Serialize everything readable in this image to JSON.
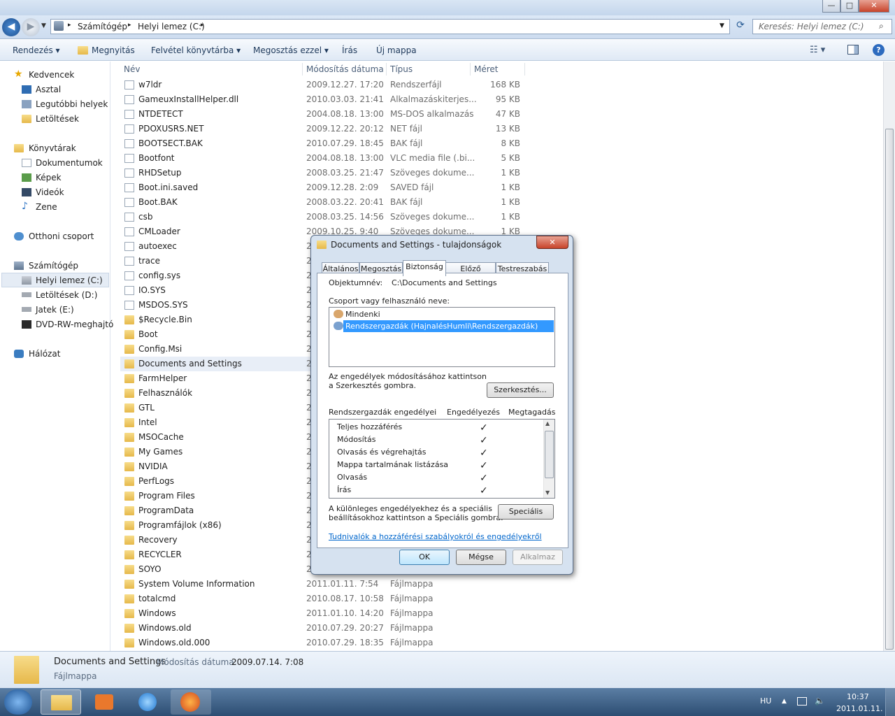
{
  "titlebar": {
    "minimize": "—",
    "maximize": "□",
    "close": "✕"
  },
  "address": {
    "part1": "Számítógép",
    "sep": "▸",
    "part2": "Helyi lemez (C:)",
    "sep2": "▸"
  },
  "search": {
    "placeholder": "Keresés: Helyi lemez (C:)"
  },
  "toolbar": {
    "organize": "Rendezés ▾",
    "open": "Megnyitás",
    "library": "Felvétel könyvtárba ▾",
    "share": "Megosztás ezzel ▾",
    "burn": "Írás",
    "newfolder": "Új mappa"
  },
  "sidebar": {
    "favorites": "Kedvencek",
    "desktop": "Asztal",
    "recent": "Legutóbbi helyek",
    "downloads": "Letöltések",
    "libraries": "Könyvtárak",
    "documents": "Dokumentumok",
    "pictures": "Képek",
    "videos": "Videók",
    "music": "Zene",
    "homegroup": "Otthoni csoport",
    "computer": "Számítógép",
    "drive_c": "Helyi lemez (C:)",
    "drive_d": "Letöltések (D:)",
    "drive_e": "Jatek (E:)",
    "dvd": "DVD-RW-meghajtó",
    "network": "Hálózat"
  },
  "columns": {
    "name": "Név",
    "date": "Módosítás dátuma",
    "type": "Típus",
    "size": "Méret"
  },
  "files": [
    {
      "name": "w7ldr",
      "date": "2009.12.27. 17:20",
      "type": "Rendszerfájl",
      "size": "168 KB",
      "kind": "file"
    },
    {
      "name": "GameuxInstallHelper.dll",
      "date": "2010.03.03. 21:41",
      "type": "Alkalmazáskiterjes...",
      "size": "95 KB",
      "kind": "file"
    },
    {
      "name": "NTDETECT",
      "date": "2004.08.18. 13:00",
      "type": "MS-DOS alkalmazás",
      "size": "47 KB",
      "kind": "file"
    },
    {
      "name": "PDOXUSRS.NET",
      "date": "2009.12.22. 20:12",
      "type": "NET fájl",
      "size": "13 KB",
      "kind": "file"
    },
    {
      "name": "BOOTSECT.BAK",
      "date": "2010.07.29. 18:45",
      "type": "BAK fájl",
      "size": "8 KB",
      "kind": "file"
    },
    {
      "name": "Bootfont",
      "date": "2004.08.18. 13:00",
      "type": "VLC media file (.bi...",
      "size": "5 KB",
      "kind": "file"
    },
    {
      "name": "RHDSetup",
      "date": "2008.03.25. 21:47",
      "type": "Szöveges dokume...",
      "size": "1 KB",
      "kind": "file"
    },
    {
      "name": "Boot.ini.saved",
      "date": "2009.12.28. 2:09",
      "type": "SAVED fájl",
      "size": "1 KB",
      "kind": "file"
    },
    {
      "name": "Boot.BAK",
      "date": "2008.03.22. 20:41",
      "type": "BAK fájl",
      "size": "1 KB",
      "kind": "file"
    },
    {
      "name": "csb",
      "date": "2008.03.25. 14:56",
      "type": "Szöveges dokume...",
      "size": "1 KB",
      "kind": "file"
    },
    {
      "name": "CMLoader",
      "date": "2009.10.25. 9:40",
      "type": "Szöveges dokume...",
      "size": "1 KB",
      "kind": "file"
    },
    {
      "name": "autoexec",
      "date": "2",
      "type": "",
      "size": "",
      "kind": "file"
    },
    {
      "name": "trace",
      "date": "2",
      "type": "",
      "size": "",
      "kind": "file"
    },
    {
      "name": "config.sys",
      "date": "2",
      "type": "",
      "size": "",
      "kind": "file"
    },
    {
      "name": "IO.SYS",
      "date": "2",
      "type": "",
      "size": "",
      "kind": "file"
    },
    {
      "name": "MSDOS.SYS",
      "date": "2",
      "type": "",
      "size": "",
      "kind": "file"
    },
    {
      "name": "$Recycle.Bin",
      "date": "2",
      "type": "",
      "size": "",
      "kind": "folder"
    },
    {
      "name": "Boot",
      "date": "2",
      "type": "",
      "size": "",
      "kind": "folder"
    },
    {
      "name": "Config.Msi",
      "date": "2",
      "type": "",
      "size": "",
      "kind": "folder"
    },
    {
      "name": "Documents and Settings",
      "date": "2",
      "type": "",
      "size": "",
      "kind": "folder"
    },
    {
      "name": "FarmHelper",
      "date": "2",
      "type": "",
      "size": "",
      "kind": "folder"
    },
    {
      "name": "Felhasználók",
      "date": "2",
      "type": "",
      "size": "",
      "kind": "folder"
    },
    {
      "name": "GTL",
      "date": "2",
      "type": "",
      "size": "",
      "kind": "folder"
    },
    {
      "name": "Intel",
      "date": "2",
      "type": "",
      "size": "",
      "kind": "folder"
    },
    {
      "name": "MSOCache",
      "date": "2",
      "type": "",
      "size": "",
      "kind": "folder"
    },
    {
      "name": "My Games",
      "date": "2",
      "type": "",
      "size": "",
      "kind": "folder"
    },
    {
      "name": "NVIDIA",
      "date": "2",
      "type": "",
      "size": "",
      "kind": "folder"
    },
    {
      "name": "PerfLogs",
      "date": "2",
      "type": "",
      "size": "",
      "kind": "folder"
    },
    {
      "name": "Program Files",
      "date": "2",
      "type": "",
      "size": "",
      "kind": "folder"
    },
    {
      "name": "ProgramData",
      "date": "2",
      "type": "",
      "size": "",
      "kind": "folder"
    },
    {
      "name": "Programfájlok (x86)",
      "date": "2",
      "type": "",
      "size": "",
      "kind": "folder"
    },
    {
      "name": "Recovery",
      "date": "2",
      "type": "",
      "size": "",
      "kind": "folder"
    },
    {
      "name": "RECYCLER",
      "date": "2",
      "type": "",
      "size": "",
      "kind": "folder"
    },
    {
      "name": "SOYO",
      "date": "2",
      "type": "",
      "size": "",
      "kind": "folder"
    },
    {
      "name": "System Volume Information",
      "date": "2011.01.11. 7:54",
      "type": "Fájlmappa",
      "size": "",
      "kind": "folder"
    },
    {
      "name": "totalcmd",
      "date": "2010.08.17. 10:58",
      "type": "Fájlmappa",
      "size": "",
      "kind": "folder"
    },
    {
      "name": "Windows",
      "date": "2011.01.10. 14:20",
      "type": "Fájlmappa",
      "size": "",
      "kind": "folder"
    },
    {
      "name": "Windows.old",
      "date": "2010.07.29. 20:27",
      "type": "Fájlmappa",
      "size": "",
      "kind": "folder"
    },
    {
      "name": "Windows.old.000",
      "date": "2010.07.29. 18:35",
      "type": "Fájlmappa",
      "size": "",
      "kind": "folder"
    }
  ],
  "details": {
    "name": "Documents and Settings",
    "date_label": "Módosítás dátuma:",
    "date_value": "2009.07.14. 7:08",
    "type": "Fájlmappa"
  },
  "taskbar": {
    "lang": "HU",
    "time": "10:37",
    "date": "2011.01.11."
  },
  "dialog": {
    "title": "Documents and Settings - tulajdonságok",
    "close": "✕",
    "tabs": [
      "Általános",
      "Megosztás",
      "Biztonság",
      "Előző verziók",
      "Testreszabás"
    ],
    "object_label": "Objektumnév:",
    "object_value": "C:\\Documents and Settings",
    "group_label": "Csoport vagy felhasználó neve:",
    "users": [
      "Mindenki",
      "Rendszergazdák (HajnalésHumli\\Rendszergazdák)"
    ],
    "edit_hint_1": "Az engedélyek módosításához kattintson",
    "edit_hint_2": "a Szerkesztés gombra.",
    "edit_button": "Szerkesztés...",
    "perm_header": "Rendszergazdák engedélyei",
    "allow_header": "Engedélyezés",
    "deny_header": "Megtagadás",
    "permissions": [
      "Teljes hozzáférés",
      "Módosítás",
      "Olvasás és végrehajtás",
      "Mappa tartalmának listázása",
      "Olvasás",
      "Írás"
    ],
    "check": "✓",
    "special_hint_1": "A különleges engedélyekhez és a speciális",
    "special_hint_2": "beállításokhoz kattintson a Speciális gombra.",
    "special_button": "Speciális",
    "link": "Tudnivalók a hozzáférési szabályokról és engedélyekről",
    "ok": "OK",
    "cancel": "Mégse",
    "apply": "Alkalmaz"
  }
}
